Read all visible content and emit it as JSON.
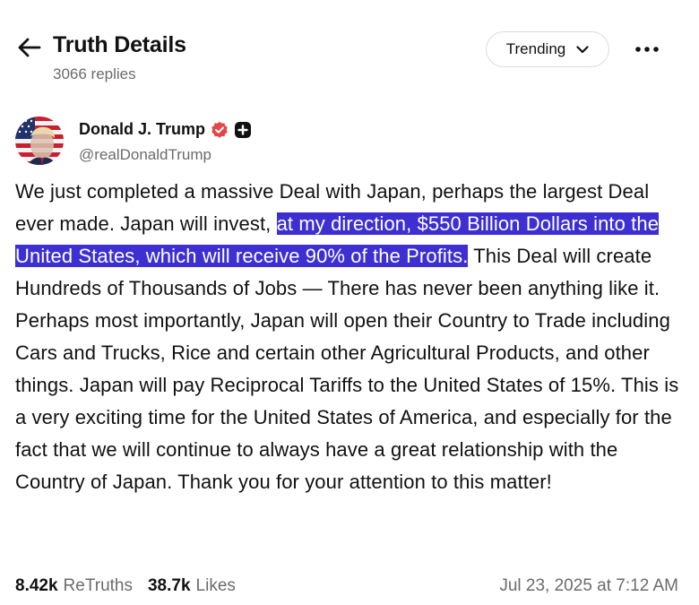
{
  "header": {
    "title": "Truth Details",
    "replies": "3066 replies",
    "sort_label": "Trending",
    "back_icon": "arrow-left-icon",
    "more_icon": "ellipsis-icon"
  },
  "author": {
    "name": "Donald J. Trump",
    "handle": "@realDonaldTrump",
    "verified_color": "#e04848",
    "badge_icon": "plus-badge-icon"
  },
  "post": {
    "text_before": "We just completed a massive Deal with Japan, perhaps the largest Deal ever made. Japan will invest, ",
    "text_highlighted": "at my direction, $550 Billion Dollars into the United States, which will receive 90% of the Profits.",
    "text_after": " This Deal will create Hundreds of Thousands of Jobs — There has never been anything like it. Perhaps most importantly, Japan will open their Country to Trade including Cars and Trucks, Rice and certain other Agricultural Products, and other things. Japan will pay Reciprocal Tariffs to the United States of 15%. This is a very exciting time for the United States of America, and especially for the fact that we will continue to always have a great relationship with the Country of Japan. Thank you for your attention to this matter!",
    "highlight_color": "#3d2fd1"
  },
  "footer": {
    "retruths_count": "8.42k",
    "retruths_label": "ReTruths",
    "likes_count": "38.7k",
    "likes_label": "Likes",
    "timestamp": "Jul 23, 2025 at 7:12 AM"
  }
}
